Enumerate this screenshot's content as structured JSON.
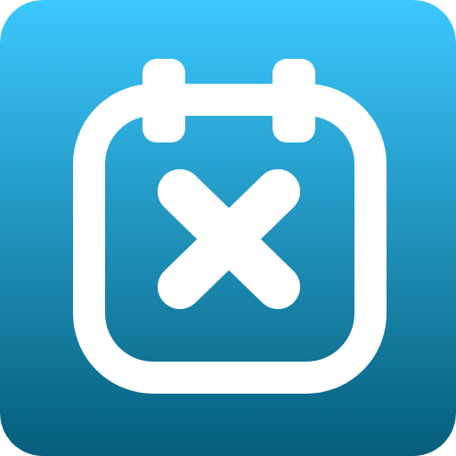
{
  "icon": {
    "name": "calendar-cancel-icon",
    "glyph": "calendar-with-x",
    "colors": {
      "gradient_top": "#3CC8FF",
      "gradient_bottom": "#055E7B",
      "foreground": "#FFFFFF"
    }
  }
}
